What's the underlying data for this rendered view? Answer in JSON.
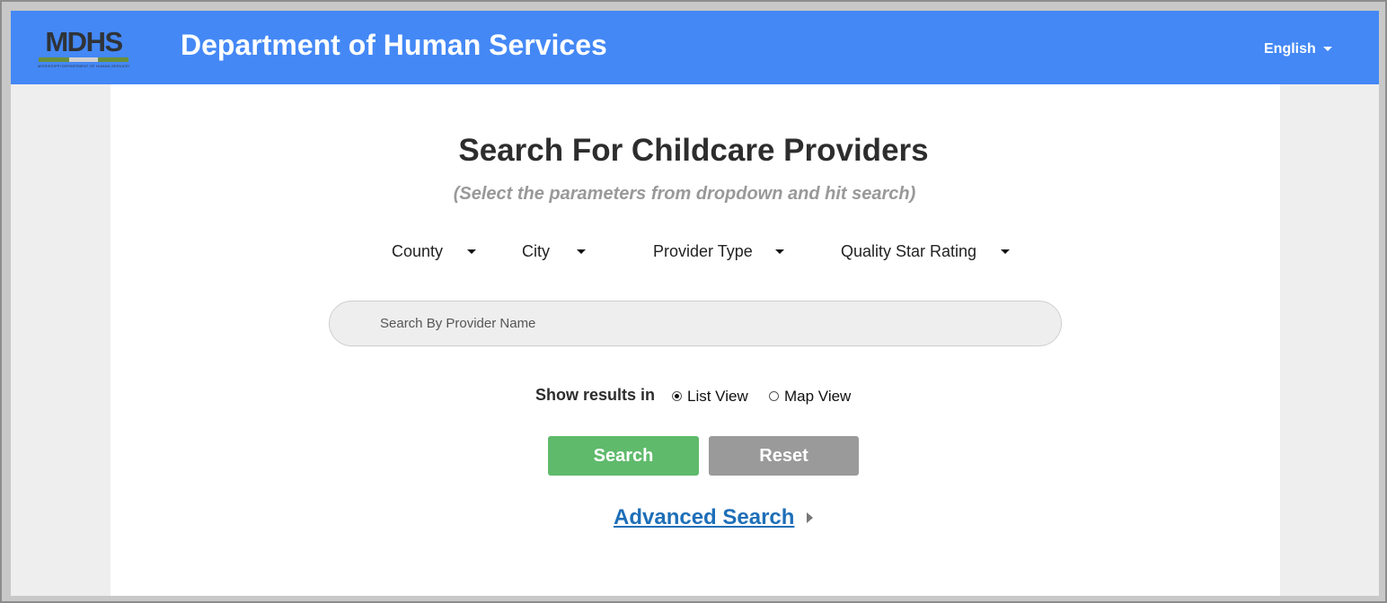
{
  "header": {
    "logo_text": "MDHS",
    "logo_tagline": "MISSISSIPPI DEPARTMENT OF HUMAN SERVICES",
    "logo_bar_colors": [
      "#6a8f3a",
      "#d0d0d0",
      "#6a8f3a"
    ],
    "title": "Department of Human Services",
    "language": "English",
    "bg_color": "#4488f6"
  },
  "main": {
    "title": "Search For Childcare Providers",
    "subtitle": "(Select the parameters from dropdown and hit search)",
    "filters": [
      {
        "label": "County",
        "icon": "chevron-down-icon"
      },
      {
        "label": "City",
        "icon": "chevron-down-icon"
      },
      {
        "label": "Provider Type",
        "icon": "chevron-down-icon"
      },
      {
        "label": "Quality Star Rating",
        "icon": "chevron-down-icon"
      }
    ],
    "search": {
      "placeholder": "Search By Provider Name",
      "value": ""
    },
    "show_results": {
      "label": "Show results in",
      "options": [
        {
          "label": "List View",
          "checked": true
        },
        {
          "label": "Map View",
          "checked": false
        }
      ]
    },
    "buttons": {
      "search_label": "Search",
      "reset_label": "Reset",
      "search_color": "#5fba6b",
      "reset_color": "#9a9a9a"
    },
    "advanced_search": {
      "label": "Advanced Search",
      "icon": "chevron-right-icon",
      "color": "#1e6fb8"
    }
  }
}
